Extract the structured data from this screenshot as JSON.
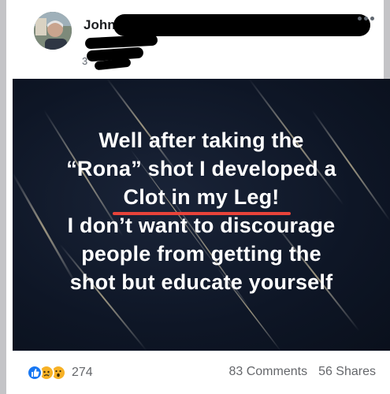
{
  "post": {
    "author_visible": "John",
    "meta_visible": "3",
    "more_icon": "more-horizontal-icon"
  },
  "image": {
    "lines": [
      "Well after taking the",
      "“Rona” shot I developed a",
      "Clot in my Leg!",
      "I don’t want to discourage",
      "people from getting the",
      "shot but educate yourself"
    ],
    "underline_color": "#e8433a",
    "background_color": "#0e1626"
  },
  "footer": {
    "reaction_icons": [
      "like-reaction-icon",
      "sad-reaction-icon",
      "wow-reaction-icon"
    ],
    "reaction_count": "274",
    "comments": "83 Comments",
    "shares": "56 Shares"
  },
  "colors": {
    "like": "#1877f2",
    "emoji": "#f7b125",
    "muted_text": "#65676b"
  }
}
